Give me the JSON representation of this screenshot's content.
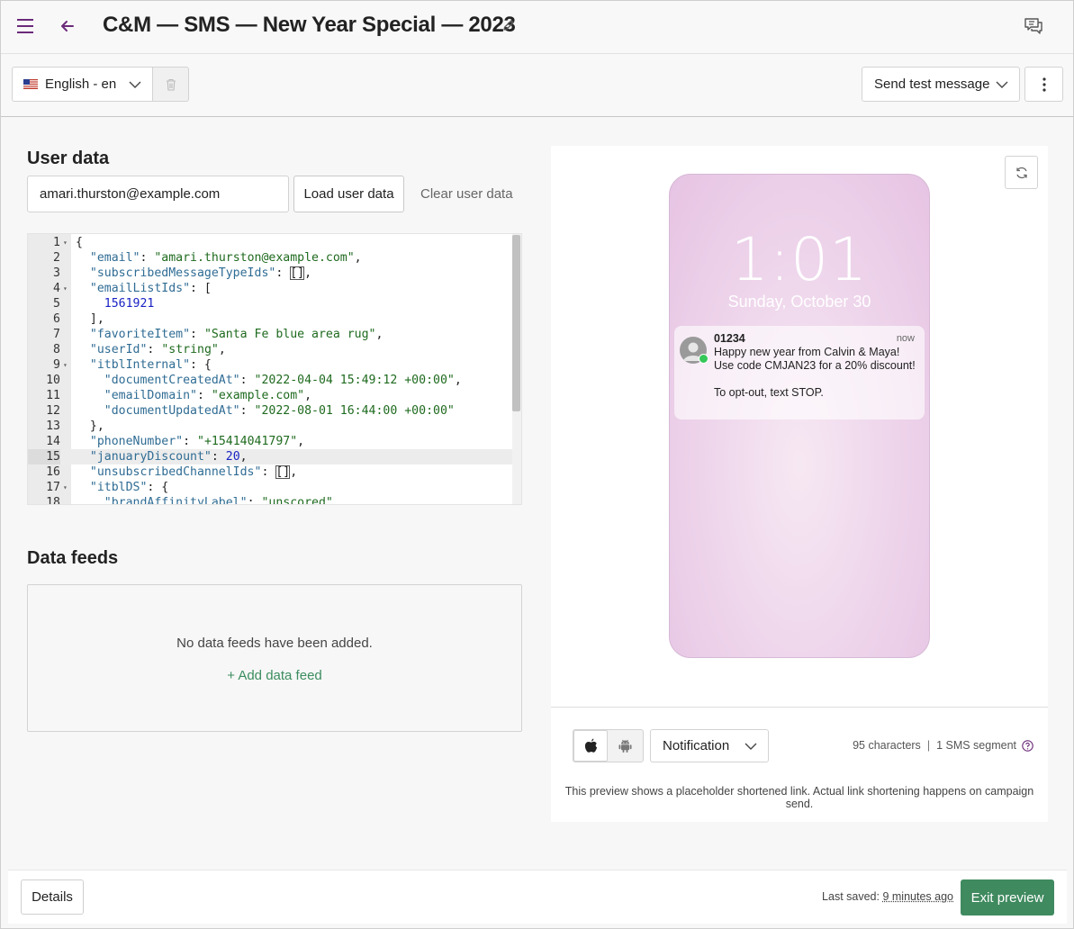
{
  "header": {
    "title": "C&M — SMS — New Year Special — 2023"
  },
  "toolbar": {
    "language": "English - en",
    "send_test": "Send test message"
  },
  "user_data": {
    "title": "User data",
    "email_value": "amari.thurston@example.com",
    "load_label": "Load user data",
    "clear_label": "Clear user data",
    "active_line": 15,
    "code_lines": [
      [
        {
          "t": "p",
          "v": "{"
        }
      ],
      [
        {
          "t": "p",
          "v": "  "
        },
        {
          "t": "k",
          "v": "\"email\""
        },
        {
          "t": "p",
          "v": ": "
        },
        {
          "t": "s",
          "v": "\"amari.thurston@example.com\""
        },
        {
          "t": "p",
          "v": ","
        }
      ],
      [
        {
          "t": "p",
          "v": "  "
        },
        {
          "t": "k",
          "v": "\"subscribedMessageTypeIds\""
        },
        {
          "t": "p",
          "v": ": "
        },
        {
          "t": "b",
          "v": "[]"
        },
        {
          "t": "p",
          "v": ","
        }
      ],
      [
        {
          "t": "p",
          "v": "  "
        },
        {
          "t": "k",
          "v": "\"emailListIds\""
        },
        {
          "t": "p",
          "v": ": ["
        }
      ],
      [
        {
          "t": "p",
          "v": "    "
        },
        {
          "t": "n",
          "v": "1561921"
        }
      ],
      [
        {
          "t": "p",
          "v": "  ],"
        }
      ],
      [
        {
          "t": "p",
          "v": "  "
        },
        {
          "t": "k",
          "v": "\"favoriteItem\""
        },
        {
          "t": "p",
          "v": ": "
        },
        {
          "t": "s",
          "v": "\"Santa Fe blue area rug\""
        },
        {
          "t": "p",
          "v": ","
        }
      ],
      [
        {
          "t": "p",
          "v": "  "
        },
        {
          "t": "k",
          "v": "\"userId\""
        },
        {
          "t": "p",
          "v": ": "
        },
        {
          "t": "s",
          "v": "\"string\""
        },
        {
          "t": "p",
          "v": ","
        }
      ],
      [
        {
          "t": "p",
          "v": "  "
        },
        {
          "t": "k",
          "v": "\"itblInternal\""
        },
        {
          "t": "p",
          "v": ": {"
        }
      ],
      [
        {
          "t": "p",
          "v": "    "
        },
        {
          "t": "k",
          "v": "\"documentCreatedAt\""
        },
        {
          "t": "p",
          "v": ": "
        },
        {
          "t": "s",
          "v": "\"2022-04-04 15:49:12 +00:00\""
        },
        {
          "t": "p",
          "v": ","
        }
      ],
      [
        {
          "t": "p",
          "v": "    "
        },
        {
          "t": "k",
          "v": "\"emailDomain\""
        },
        {
          "t": "p",
          "v": ": "
        },
        {
          "t": "s",
          "v": "\"example.com\""
        },
        {
          "t": "p",
          "v": ","
        }
      ],
      [
        {
          "t": "p",
          "v": "    "
        },
        {
          "t": "k",
          "v": "\"documentUpdatedAt\""
        },
        {
          "t": "p",
          "v": ": "
        },
        {
          "t": "s",
          "v": "\"2022-08-01 16:44:00 +00:00\""
        }
      ],
      [
        {
          "t": "p",
          "v": "  },"
        }
      ],
      [
        {
          "t": "p",
          "v": "  "
        },
        {
          "t": "k",
          "v": "\"phoneNumber\""
        },
        {
          "t": "p",
          "v": ": "
        },
        {
          "t": "s",
          "v": "\"+15414041797\""
        },
        {
          "t": "p",
          "v": ","
        }
      ],
      [
        {
          "t": "p",
          "v": "  "
        },
        {
          "t": "k",
          "v": "\"januaryDiscount\""
        },
        {
          "t": "p",
          "v": ": "
        },
        {
          "t": "n",
          "v": "20"
        },
        {
          "t": "p",
          "v": ","
        }
      ],
      [
        {
          "t": "p",
          "v": "  "
        },
        {
          "t": "k",
          "v": "\"unsubscribedChannelIds\""
        },
        {
          "t": "p",
          "v": ": "
        },
        {
          "t": "b",
          "v": "[]"
        },
        {
          "t": "p",
          "v": ","
        }
      ],
      [
        {
          "t": "p",
          "v": "  "
        },
        {
          "t": "k",
          "v": "\"itblDS\""
        },
        {
          "t": "p",
          "v": ": {"
        }
      ],
      [
        {
          "t": "p",
          "v": "    "
        },
        {
          "t": "k",
          "v": "\"brandAffinityLabel\""
        },
        {
          "t": "p",
          "v": ": "
        },
        {
          "t": "s",
          "v": "\"unscored\""
        }
      ]
    ],
    "foldable_lines": [
      1,
      4,
      9,
      17
    ]
  },
  "data_feeds": {
    "title": "Data feeds",
    "empty_message": "No data feeds have been added.",
    "add_label": "+ Add data feed"
  },
  "preview": {
    "time": "1:01",
    "date": "Sunday, October 30",
    "notification": {
      "sender": "01234",
      "time": "now",
      "body": "Happy new year from Calvin & Maya! Use code CMJAN23 for a 20% discount!\n\nTo opt-out, text STOP."
    },
    "view_mode": "Notification",
    "selected_platform": "ios",
    "characters": "95 characters",
    "segments": "1 SMS segment",
    "note": "This preview shows a placeholder shortened link. Actual link shortening happens on campaign send."
  },
  "footer": {
    "details_label": "Details",
    "last_saved_label": "Last saved:",
    "last_saved_value": "9 minutes ago",
    "exit_label": "Exit preview"
  },
  "colors": {
    "accent_purple": "#6b2a7a",
    "accent_green": "#3f8a5f",
    "phone_background": "#ecd0e9"
  }
}
